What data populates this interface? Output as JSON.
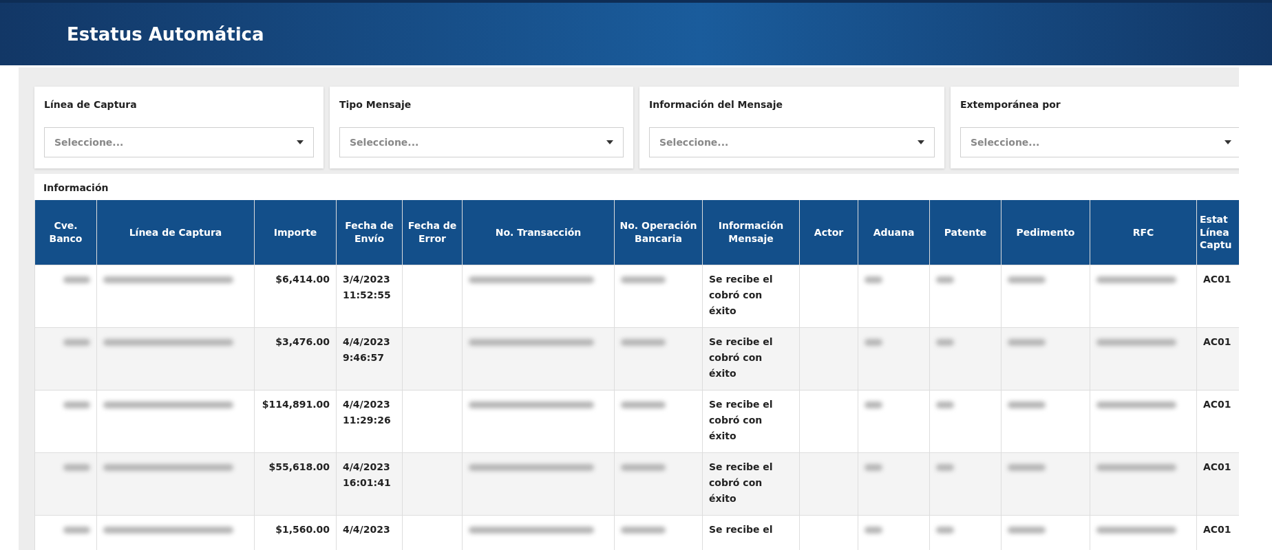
{
  "header": {
    "title": "Estatus Automática"
  },
  "filters": [
    {
      "label": "Línea de Captura",
      "placeholder": "Seleccione..."
    },
    {
      "label": "Tipo Mensaje",
      "placeholder": "Seleccione..."
    },
    {
      "label": "Información del Mensaje",
      "placeholder": "Seleccione..."
    },
    {
      "label": "Extemporánea por",
      "placeholder": "Seleccione..."
    }
  ],
  "table": {
    "title": "Información",
    "columns": [
      "Cve. Banco",
      "Línea de Captura",
      "Importe",
      "Fecha de Envío",
      "Fecha de Error",
      "No. Transacción",
      "No. Operación Bancaria",
      "Información Mensaje",
      "Actor",
      "Aduana",
      "Patente",
      "Pedimento",
      "RFC",
      "Estat\nLínea\nCaptu"
    ],
    "rows": [
      {
        "cells": [
          {
            "kind": "blurred"
          },
          {
            "kind": "blurred"
          },
          {
            "kind": "text",
            "text": "$6,414.00"
          },
          {
            "kind": "text",
            "text": "3/4/2023 11:52:55"
          },
          {
            "kind": "blank"
          },
          {
            "kind": "blurred"
          },
          {
            "kind": "blurred"
          },
          {
            "kind": "text",
            "text": "Se recibe el cobró con éxito"
          },
          {
            "kind": "blank"
          },
          {
            "kind": "blurred"
          },
          {
            "kind": "blurred"
          },
          {
            "kind": "blurred"
          },
          {
            "kind": "blurred"
          },
          {
            "kind": "text",
            "text": "AC01"
          }
        ]
      },
      {
        "cells": [
          {
            "kind": "blurred"
          },
          {
            "kind": "blurred"
          },
          {
            "kind": "text",
            "text": "$3,476.00"
          },
          {
            "kind": "text",
            "text": "4/4/2023 9:46:57"
          },
          {
            "kind": "blank"
          },
          {
            "kind": "blurred"
          },
          {
            "kind": "blurred"
          },
          {
            "kind": "text",
            "text": "Se recibe el cobró con éxito"
          },
          {
            "kind": "blank"
          },
          {
            "kind": "blurred"
          },
          {
            "kind": "blurred"
          },
          {
            "kind": "blurred"
          },
          {
            "kind": "blurred"
          },
          {
            "kind": "text",
            "text": "AC01"
          }
        ]
      },
      {
        "cells": [
          {
            "kind": "blurred"
          },
          {
            "kind": "blurred"
          },
          {
            "kind": "text",
            "text": "$114,891.00"
          },
          {
            "kind": "text",
            "text": "4/4/2023 11:29:26"
          },
          {
            "kind": "blank"
          },
          {
            "kind": "blurred"
          },
          {
            "kind": "blurred"
          },
          {
            "kind": "text",
            "text": "Se recibe el cobró con éxito"
          },
          {
            "kind": "blank"
          },
          {
            "kind": "blurred"
          },
          {
            "kind": "blurred"
          },
          {
            "kind": "blurred"
          },
          {
            "kind": "blurred"
          },
          {
            "kind": "text",
            "text": "AC01"
          }
        ]
      },
      {
        "cells": [
          {
            "kind": "blurred"
          },
          {
            "kind": "blurred"
          },
          {
            "kind": "text",
            "text": "$55,618.00"
          },
          {
            "kind": "text",
            "text": "4/4/2023 16:01:41"
          },
          {
            "kind": "blank"
          },
          {
            "kind": "blurred"
          },
          {
            "kind": "blurred"
          },
          {
            "kind": "text",
            "text": "Se recibe el cobró con éxito"
          },
          {
            "kind": "blank"
          },
          {
            "kind": "blurred"
          },
          {
            "kind": "blurred"
          },
          {
            "kind": "blurred"
          },
          {
            "kind": "blurred"
          },
          {
            "kind": "text",
            "text": "AC01"
          }
        ]
      },
      {
        "cells": [
          {
            "kind": "blurred"
          },
          {
            "kind": "blurred"
          },
          {
            "kind": "text",
            "text": "$1,560.00"
          },
          {
            "kind": "text",
            "text": "4/4/2023"
          },
          {
            "kind": "blank"
          },
          {
            "kind": "blurred"
          },
          {
            "kind": "blurred"
          },
          {
            "kind": "text",
            "text": "Se recibe el"
          },
          {
            "kind": "blank"
          },
          {
            "kind": "blurred"
          },
          {
            "kind": "blurred"
          },
          {
            "kind": "blurred"
          },
          {
            "kind": "blurred"
          },
          {
            "kind": "text",
            "text": "AC01"
          }
        ]
      }
    ]
  }
}
